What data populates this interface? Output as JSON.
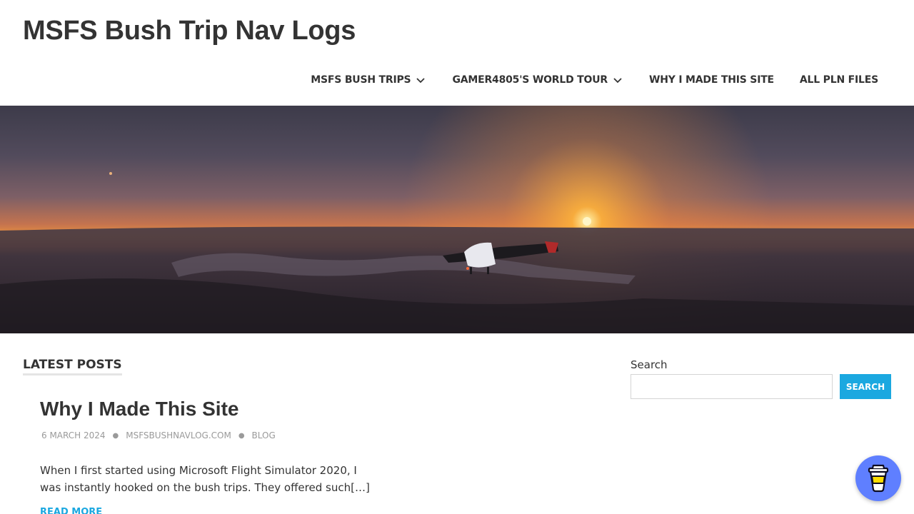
{
  "site": {
    "title": "MSFS Bush Trip Nav Logs"
  },
  "nav": {
    "items": [
      {
        "label": "MSFS BUSH TRIPS",
        "has_dropdown": true
      },
      {
        "label": "GAMER4805'S WORLD TOUR",
        "has_dropdown": true
      },
      {
        "label": "WHY I MADE THIS SITE",
        "has_dropdown": false
      },
      {
        "label": "ALL PLN FILES",
        "has_dropdown": false
      }
    ]
  },
  "hero": {
    "icon": "sunset-flight-banner"
  },
  "main": {
    "section_title": "LATEST POSTS",
    "post": {
      "title": "Why I Made This Site",
      "date": "6 MARCH 2024",
      "author": "MSFSBUSHNAVLOG.COM",
      "category": "BLOG",
      "excerpt": "When I first started using Microsoft Flight Simulator 2020, I was instantly hooked on the bush trips. They offered such[…]",
      "read_more": "READ MORE"
    }
  },
  "sidebar": {
    "search": {
      "label": "Search",
      "placeholder": "",
      "value": "",
      "button_label": "SEARCH"
    }
  },
  "colors": {
    "accent": "#1ba8e0",
    "bmc": "#5f7fff",
    "text": "#333333"
  },
  "floating": {
    "icon": "coffee-cup-icon"
  }
}
